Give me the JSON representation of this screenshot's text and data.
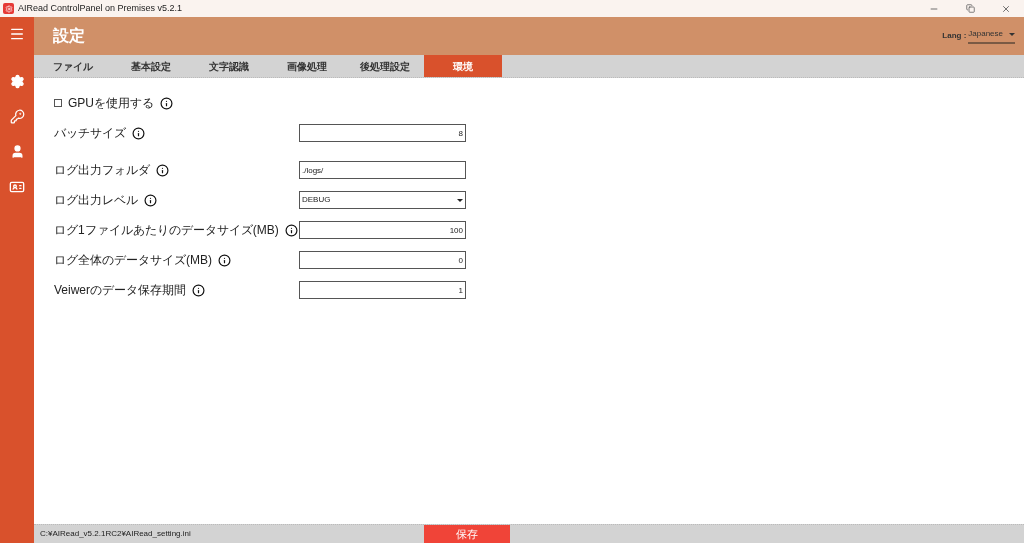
{
  "window": {
    "title": "AIRead ControlPanel on Premises v5.2.1"
  },
  "header": {
    "title": "設定",
    "lang_label": "Lang :",
    "lang_value": "Japanese"
  },
  "tabs": [
    {
      "label": "ファイル",
      "selected": false
    },
    {
      "label": "基本設定",
      "selected": false
    },
    {
      "label": "文字認識",
      "selected": false
    },
    {
      "label": "画像処理",
      "selected": false
    },
    {
      "label": "後処理設定",
      "selected": false
    },
    {
      "label": "環境",
      "selected": true
    }
  ],
  "settings": [
    {
      "kind": "checkbox",
      "label": "GPUを使用する",
      "checked": false
    },
    {
      "kind": "number",
      "label": "バッチサイズ",
      "value": "8"
    },
    {
      "kind": "text",
      "label": "ログ出力フォルダ",
      "value": "./logs/"
    },
    {
      "kind": "select",
      "label": "ログ出力レベル",
      "value": "DEBUG"
    },
    {
      "kind": "number",
      "label": "ログ1ファイルあたりのデータサイズ(MB)",
      "value": "100"
    },
    {
      "kind": "number",
      "label": "ログ全体のデータサイズ(MB)",
      "value": "0"
    },
    {
      "kind": "number",
      "label": "Veiwerのデータ保存期間",
      "value": "1"
    }
  ],
  "status_bar": {
    "path": "C:¥AIRead_v5.2.1RC2¥AIRead_setting.ini",
    "save_button": "保存"
  }
}
